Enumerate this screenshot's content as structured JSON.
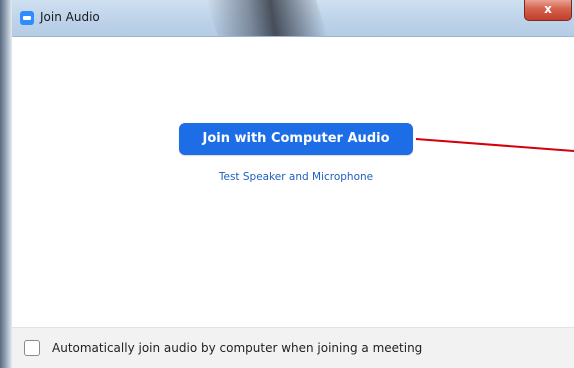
{
  "window": {
    "title": "Join Audio",
    "close_label": "x"
  },
  "main": {
    "join_button_label": "Join with Computer Audio",
    "test_link_label": "Test Speaker and Microphone"
  },
  "footer": {
    "auto_join_label": "Automatically join audio by computer when joining a meeting",
    "auto_join_checked": false
  },
  "annotation": {
    "arrow_color": "#d4000b"
  },
  "colors": {
    "accent": "#1d6ee6",
    "link": "#1f5fbf"
  },
  "icons": {
    "app": "zoom-app-icon",
    "close": "close-icon",
    "checkbox": "checkbox-unchecked"
  }
}
